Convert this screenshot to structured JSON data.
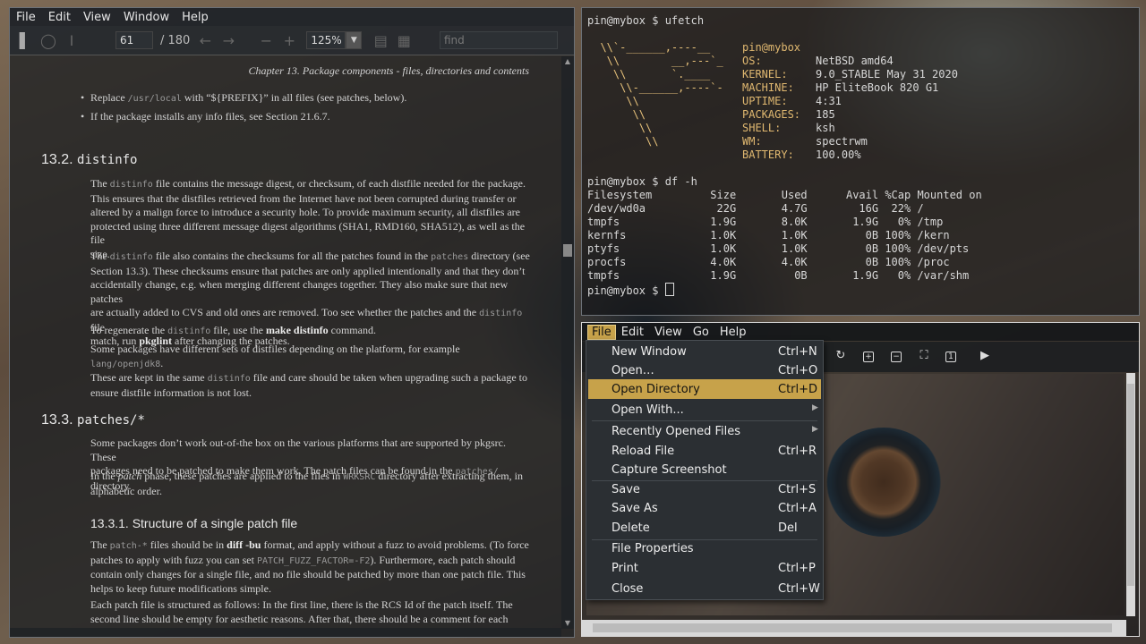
{
  "pdf_viewer": {
    "menu": [
      "File",
      "Edit",
      "View",
      "Window",
      "Help"
    ],
    "page_current": "61",
    "page_total": "/ 180",
    "zoom": "125%",
    "find_placeholder": "find",
    "doc": {
      "chapter_header": "Chapter 13. Package components - files, directories and contents",
      "bullet1_a": "Replace ",
      "bullet1_code": "/usr/local",
      "bullet1_b": " with “${PREFIX}” in all files (see patches, below).",
      "bullet2": "If the package installs any info files, see Section 21.6.7.",
      "h_distinfo_num": "13.2.",
      "h_distinfo_code": "distinfo",
      "p1_l1_a": "The ",
      "p1_l1_code": "distinfo",
      "p1_l1_b": " file contains the message digest, or checksum, of each distfile needed for the package.",
      "p1_l2": "This ensures that the distfiles retrieved from the Internet have not been corrupted during transfer or",
      "p1_l3": "altered by a malign force to introduce a security hole. To provide maximum security, all distfiles are",
      "p1_l4": "protected using three different message digest algorithms (SHA1, RMD160, SHA512), as well as the file",
      "p1_l5": "size.",
      "p2_l1_a": "The ",
      "p2_l1_code": "distinfo",
      "p2_l1_b": " file also contains the checksums for all the patches found in the ",
      "p2_l1_code2": "patches",
      "p2_l1_c": " directory (see",
      "p2_l2": "Section 13.3). These checksums ensure that patches are only applied intentionally and that they don’t",
      "p2_l3": "accidentally change, e.g. when merging different changes together. They also make sure that new patches",
      "p2_l4_a": "are actually added to CVS and old ones are removed. Too see whether the patches and the ",
      "p2_l4_code": "distinfo",
      "p2_l4_b": " file",
      "p2_l5_a": "match, run ",
      "p2_l5_bold": "pkglint",
      "p2_l5_b": " after changing the patches.",
      "p3_a": "To regenerate the ",
      "p3_code": "distinfo",
      "p3_b": " file, use the ",
      "p3_bold": "make distinfo",
      "p3_c": " command.",
      "p4_l1_a": "Some packages have different sets of distfiles depending on the platform, for example ",
      "p4_l1_code": "lang/openjdk8",
      "p4_l1_b": ".",
      "p4_l2_a": "These are kept in the same ",
      "p4_l2_code": "distinfo",
      "p4_l2_b": " file and care should be taken when upgrading such a package to",
      "p4_l3": "ensure distfile information is not lost.",
      "h_patches_num": "13.3.",
      "h_patches_code": "patches/*",
      "p5_l1": "Some packages don’t work out-of-the box on the various platforms that are supported by pkgsrc. These",
      "p5_l2_a": "packages need to be patched to make them work. The patch files can be found in the ",
      "p5_l2_code": "patches/",
      "p5_l2_b": " directory.",
      "p6_l1_a": "In the ",
      "p6_l1_em": "patch",
      "p6_l1_b": " phase, these patches are applied to the files in ",
      "p6_l1_code": "WRKSRC",
      "p6_l1_c": " directory after extracting them, in",
      "p6_l2": "alphabetic order.",
      "h3_title": "13.3.1. Structure of a single patch file",
      "p7_l1_a": "The ",
      "p7_l1_code": "patch-*",
      "p7_l1_b": " files should be in ",
      "p7_l1_bold": "diff -bu",
      "p7_l1_c": " format, and apply without a fuzz to avoid problems. (To force",
      "p7_l2_a": "patches to apply with fuzz you can set ",
      "p7_l2_code": "PATCH_FUZZ_FACTOR=-F2",
      "p7_l2_b": "). Furthermore, each patch should",
      "p7_l3": "contain only changes for a single file, and no file should be patched by more than one patch file. This",
      "p7_l4": "helps to keep future modifications simple.",
      "p8_l1": "Each patch file is structured as follows: In the first line, there is the RCS Id of the patch itself. The",
      "p8_l2": "second line should be empty for aesthetic reasons. After that, there should be a comment for each change"
    }
  },
  "terminal": {
    "prompt1": "pin@mybox $ ufetch",
    "ascii": [
      "  \\\\`-______,----__",
      "   \\\\        __,---`_",
      "    \\\\       `.____",
      "     \\\\-______,----`-",
      "      \\\\",
      "       \\\\",
      "        \\\\",
      "         \\\\"
    ],
    "info_user": "pin@mybox",
    "info": [
      {
        "k": "OS:",
        "v": "NetBSD amd64"
      },
      {
        "k": "KERNEL:",
        "v": "9.0_STABLE May 31 2020"
      },
      {
        "k": "MACHINE:",
        "v": "HP EliteBook 820 G1"
      },
      {
        "k": "UPTIME:",
        "v": "4:31"
      },
      {
        "k": "PACKAGES:",
        "v": "185"
      },
      {
        "k": "SHELL:",
        "v": "ksh"
      },
      {
        "k": "WM:",
        "v": "spectrwm"
      },
      {
        "k": "BATTERY:",
        "v": "100.00%"
      }
    ],
    "prompt2": "pin@mybox $ df -h",
    "df_header": "Filesystem         Size       Used      Avail %Cap Mounted on",
    "df_rows": [
      "/dev/wd0a           22G       4.7G        16G  22% /",
      "tmpfs              1.9G       8.0K       1.9G   0% /tmp",
      "kernfs             1.0K       1.0K         0B 100% /kern",
      "ptyfs              1.0K       1.0K         0B 100% /dev/pts",
      "procfs             4.0K       4.0K         0B 100% /proc",
      "tmpfs              1.9G         0B       1.9G   0% /var/shm"
    ],
    "prompt3": "pin@mybox $ "
  },
  "image_viewer": {
    "menu": [
      "File",
      "Edit",
      "View",
      "Go",
      "Help"
    ],
    "file_menu": {
      "new_window": {
        "label": "New Window",
        "shortcut": "Ctrl+N"
      },
      "open": {
        "label": "Open…",
        "shortcut": "Ctrl+O"
      },
      "open_directory": {
        "label": "Open Directory",
        "shortcut": "Ctrl+D"
      },
      "open_with": {
        "label": "Open With..."
      },
      "recent": {
        "label": "Recently Opened Files"
      },
      "reload": {
        "label": "Reload File",
        "shortcut": "Ctrl+R"
      },
      "capture": {
        "label": "Capture Screenshot"
      },
      "save": {
        "label": "Save",
        "shortcut": "Ctrl+S"
      },
      "save_as": {
        "label": "Save As",
        "shortcut": "Ctrl+A"
      },
      "delete": {
        "label": "Delete",
        "shortcut": "Del"
      },
      "properties": {
        "label": "File Properties"
      },
      "print": {
        "label": "Print",
        "shortcut": "Ctrl+P"
      },
      "close": {
        "label": "Close",
        "shortcut": "Ctrl+W"
      }
    }
  }
}
